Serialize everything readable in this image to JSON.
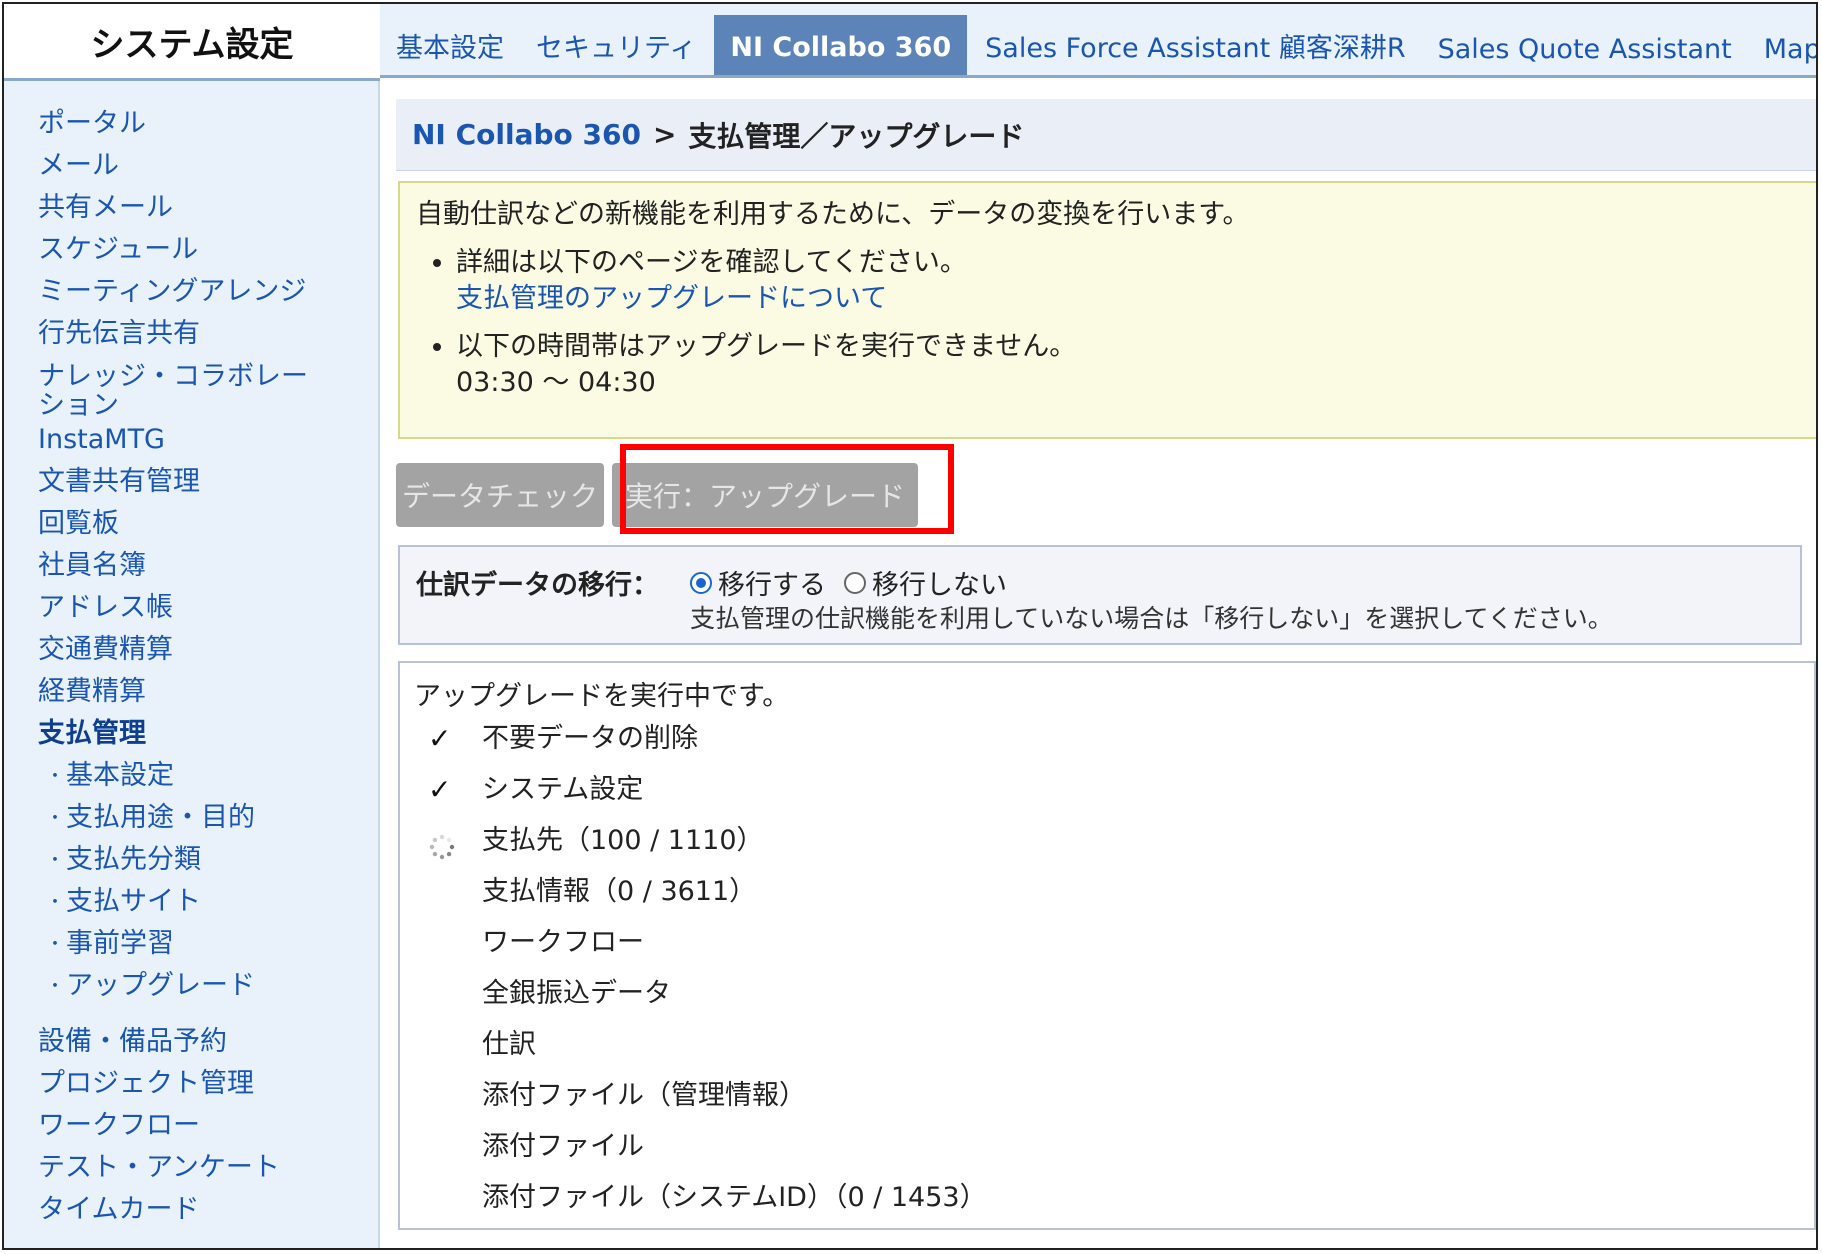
{
  "app_title": "システム設定",
  "tabs": [
    {
      "label": "基本設定",
      "active": false
    },
    {
      "label": "セキュリティ",
      "active": false
    },
    {
      "label": "NI Collabo 360",
      "active": true
    },
    {
      "label": "Sales Force Assistant 顧客深耕R",
      "active": false
    },
    {
      "label": "Sales Quote Assistant",
      "active": false
    },
    {
      "label": "MapSc",
      "active": false
    }
  ],
  "sidebar": {
    "items_top": [
      "ポータル",
      "メール",
      "共有メール",
      "スケジュール",
      "ミーティングアレンジ",
      "行先伝言共有"
    ],
    "item_wrap": "ナレッジ・コラボレーション",
    "items_mid": [
      "InstaMTG",
      "文書共有管理",
      "回覧板",
      "社員名簿",
      "アドレス帳",
      "交通費精算",
      "経費精算"
    ],
    "current": "支払管理",
    "bullet": "・",
    "subitems": [
      "基本設定",
      "支払用途・目的",
      "支払先分類",
      "支払サイト",
      "事前学習",
      "アップグレード"
    ],
    "items_bottom": [
      "設備・備品予約",
      "プロジェクト管理",
      "ワークフロー",
      "テスト・アンケート",
      "タイムカード"
    ]
  },
  "breadcrumb": {
    "root": "NI Collabo 360",
    "separator": ">",
    "current": "支払管理／アップグレード"
  },
  "notice": {
    "lead": "自動仕訳などの新機能を利用するために、データの変換を行います。",
    "bullet1_text": "詳細は以下のページを確認してください。",
    "bullet1_link": "支払管理のアップグレードについて",
    "bullet2_text": "以下の時間帯はアップグレードを実行できません。",
    "bullet2_time": "03:30 ～ 04:30"
  },
  "buttons": {
    "data_check": "データチェック",
    "execute_upgrade": "実行：アップグレード"
  },
  "migration": {
    "label": "仕訳データの移行：",
    "option_yes": "移行する",
    "option_no": "移行しない",
    "selected": "移行する",
    "note": "支払管理の仕訳機能を利用していない場合は「移行しない」を選択してください。"
  },
  "progress": {
    "status": "アップグレードを実行中です。",
    "check_mark": "✓",
    "steps": [
      {
        "label": "不要データの削除",
        "state": "done"
      },
      {
        "label": "システム設定",
        "state": "done"
      },
      {
        "label": "支払先（100 / 1110）",
        "state": "running"
      },
      {
        "label": "支払情報（0 / 3611）",
        "state": "pending"
      },
      {
        "label": "ワークフロー",
        "state": "pending"
      },
      {
        "label": "全銀振込データ",
        "state": "pending"
      },
      {
        "label": "仕訳",
        "state": "pending"
      },
      {
        "label": "添付ファイル（管理情報）",
        "state": "pending"
      },
      {
        "label": "添付ファイル",
        "state": "pending"
      },
      {
        "label": "添付ファイル（システムID）（0 / 1453）",
        "state": "pending"
      }
    ]
  },
  "colors": {
    "link": "#1a56b0",
    "tab_active_bg": "#5d84b8",
    "highlight": "#ff0000",
    "notice_bg": "#fbfbe3",
    "disabled_button": "#a3a3a3"
  }
}
